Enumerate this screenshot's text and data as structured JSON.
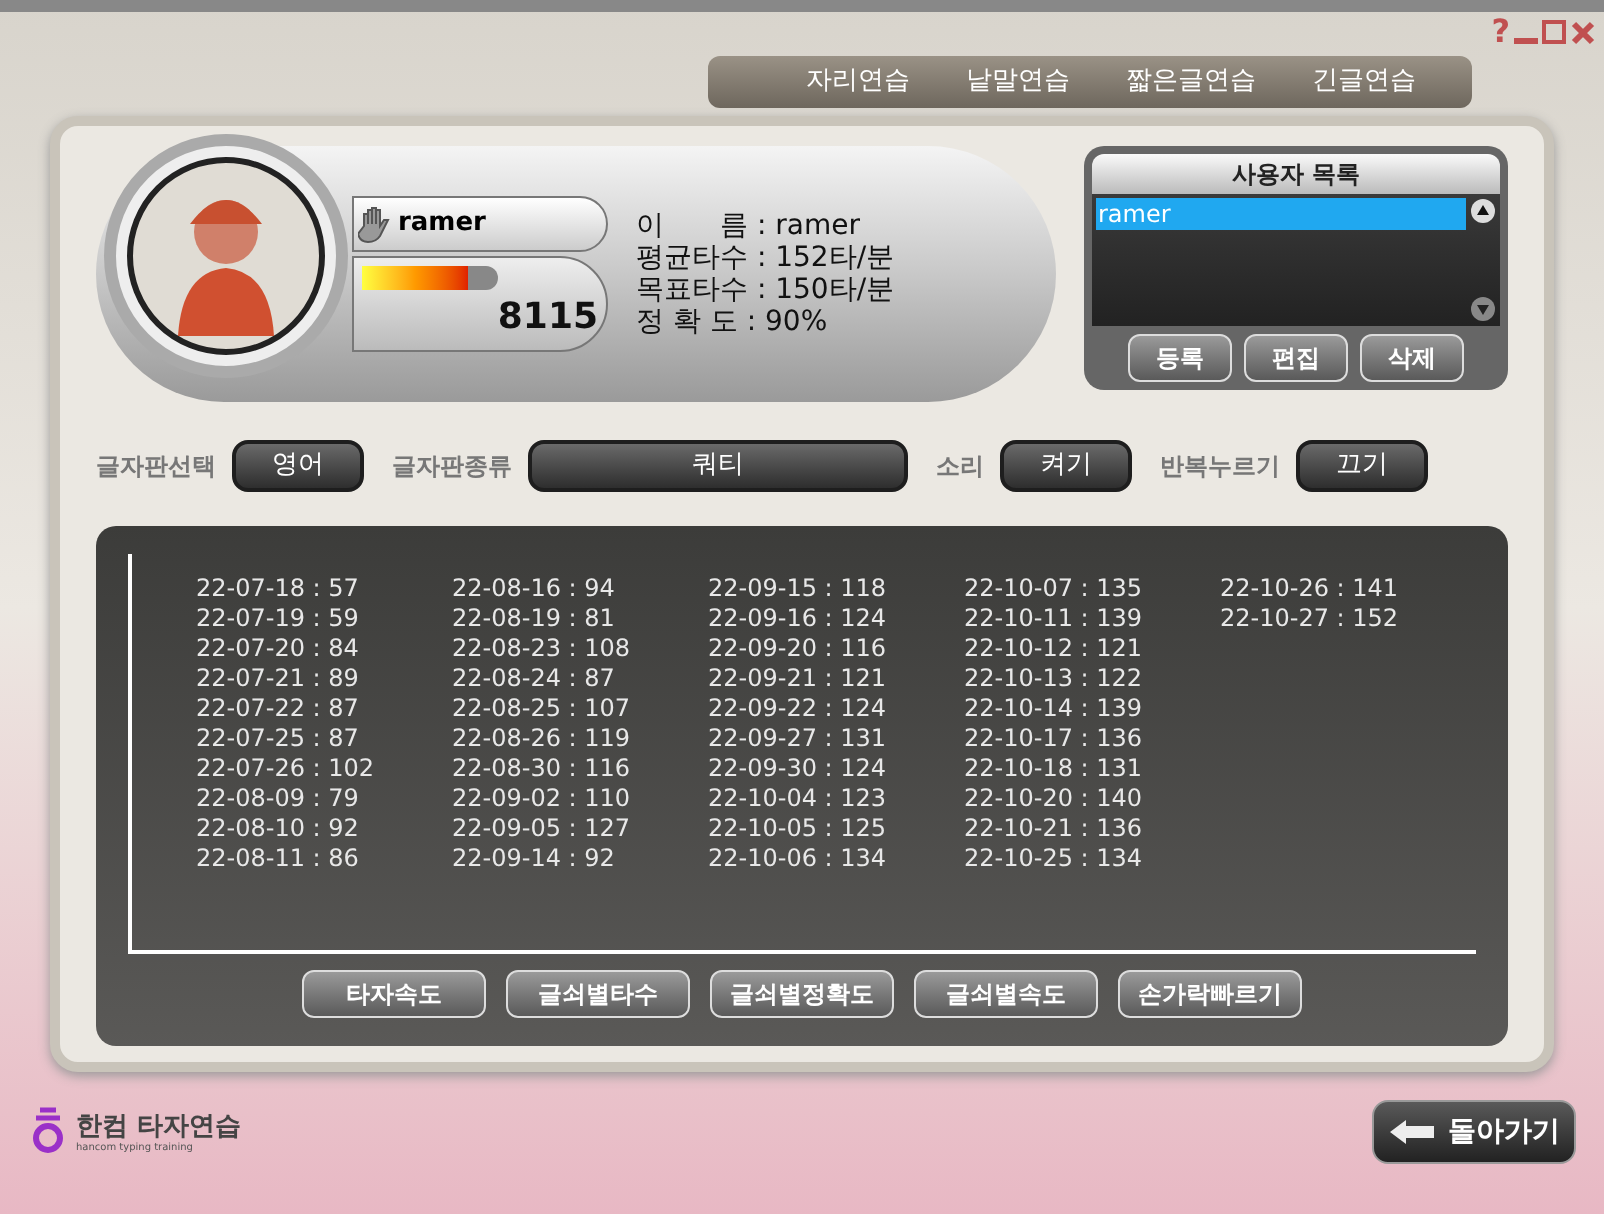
{
  "window": {
    "controls": [
      "?"
    ]
  },
  "tabs": [
    {
      "label": "자리연습",
      "selected": false
    },
    {
      "label": "낱말연습",
      "selected": false
    },
    {
      "label": "짧은글연습",
      "selected": false
    },
    {
      "label": "긴글연습",
      "selected": false
    }
  ],
  "profile": {
    "name": "ramer",
    "level": 0.78,
    "score": "8115",
    "stats": [
      "이　　름 : ramer",
      "평균타수 : 152타/분",
      "목표타수 : 150타/분",
      "정 확 도 : 90%"
    ]
  },
  "user_list": {
    "title": "사용자 목록",
    "users": [
      {
        "name": "ramer",
        "selected": true
      }
    ],
    "buttons": [
      "등록",
      "편집",
      "삭제"
    ]
  },
  "settings": [
    {
      "label": "글자판선택",
      "value": "영어"
    },
    {
      "label": "글자판종류",
      "value": "쿼티"
    },
    {
      "label": "소리",
      "value": "켜기"
    },
    {
      "label": "반복누르기",
      "value": "끄기"
    }
  ],
  "records": [
    [
      "22-07-18 : 57",
      "22-07-19 : 59",
      "22-07-20 : 84",
      "22-07-21 : 89",
      "22-07-22 : 87",
      "22-07-25 : 87",
      "22-07-26 : 102",
      "22-08-09 : 79",
      "22-08-10 : 92",
      "22-08-11 : 86"
    ],
    [
      "22-08-16 : 94",
      "22-08-19 : 81",
      "22-08-23 : 108",
      "22-08-24 : 87",
      "22-08-25 : 107",
      "22-08-26 : 119",
      "22-08-30 : 116",
      "22-09-02 : 110",
      "22-09-05 : 127",
      "22-09-14 : 92"
    ],
    [
      "22-09-15 : 118",
      "22-09-16 : 124",
      "22-09-20 : 116",
      "22-09-21 : 121",
      "22-09-22 : 124",
      "22-09-27 : 131",
      "22-09-30 : 124",
      "22-10-04 : 123",
      "22-10-05 : 125",
      "22-10-06 : 134"
    ],
    [
      "22-10-07 : 135",
      "22-10-11 : 139",
      "22-10-12 : 121",
      "22-10-13 : 122",
      "22-10-14 : 139",
      "22-10-17 : 136",
      "22-10-18 : 131",
      "22-10-20 : 140",
      "22-10-21 : 136",
      "22-10-25 : 134"
    ],
    [
      "22-10-26 : 141",
      "22-10-27 : 152"
    ]
  ],
  "view_buttons": [
    "타자속도",
    "글쇠별타수",
    "글쇠별정확도",
    "글쇠별속도",
    "손가락빠르기"
  ],
  "logo": {
    "name": "한컴 타자연습",
    "subtitle": "hancom typing training"
  },
  "back_button": "돌아가기"
}
